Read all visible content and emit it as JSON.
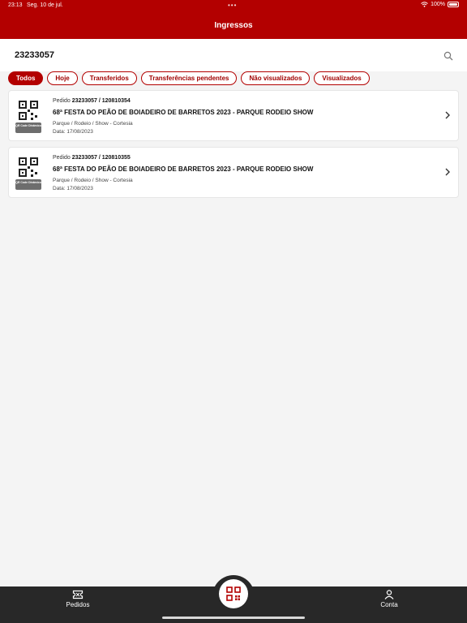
{
  "status": {
    "time": "23:13",
    "date": "Seg. 10 de jul.",
    "battery": "100%"
  },
  "header": {
    "title": "Ingressos"
  },
  "search": {
    "value": "23233057"
  },
  "filters": [
    {
      "label": "Todos",
      "active": true
    },
    {
      "label": "Hoje",
      "active": false
    },
    {
      "label": "Transferidos",
      "active": false
    },
    {
      "label": "Transferências pendentes",
      "active": false
    },
    {
      "label": "Não visualizados",
      "active": false
    },
    {
      "label": "Visualizados",
      "active": false
    }
  ],
  "qr_label": "QR Code Dinâmico",
  "orders": [
    {
      "prefix": "Pedido",
      "number": "23233057 / 120810354",
      "title": "68ª FESTA DO PEÃO DE BOIADEIRO DE BARRETOS 2023 - PARQUE RODEIO SHOW",
      "category": "Parque / Rodeio / Show - Cortesia",
      "date": "Data: 17/08/2023"
    },
    {
      "prefix": "Pedido",
      "number": "23233057 / 120810355",
      "title": "68ª FESTA DO PEÃO DE BOIADEIRO DE BARRETOS 2023 - PARQUE RODEIO SHOW",
      "category": "Parque / Rodeio / Show - Cortesia",
      "date": "Data: 17/08/2023"
    }
  ],
  "tabs": {
    "orders": "Pedidos",
    "account": "Conta"
  },
  "colors": {
    "brand": "#b30000",
    "bottom_bar": "#282828"
  }
}
